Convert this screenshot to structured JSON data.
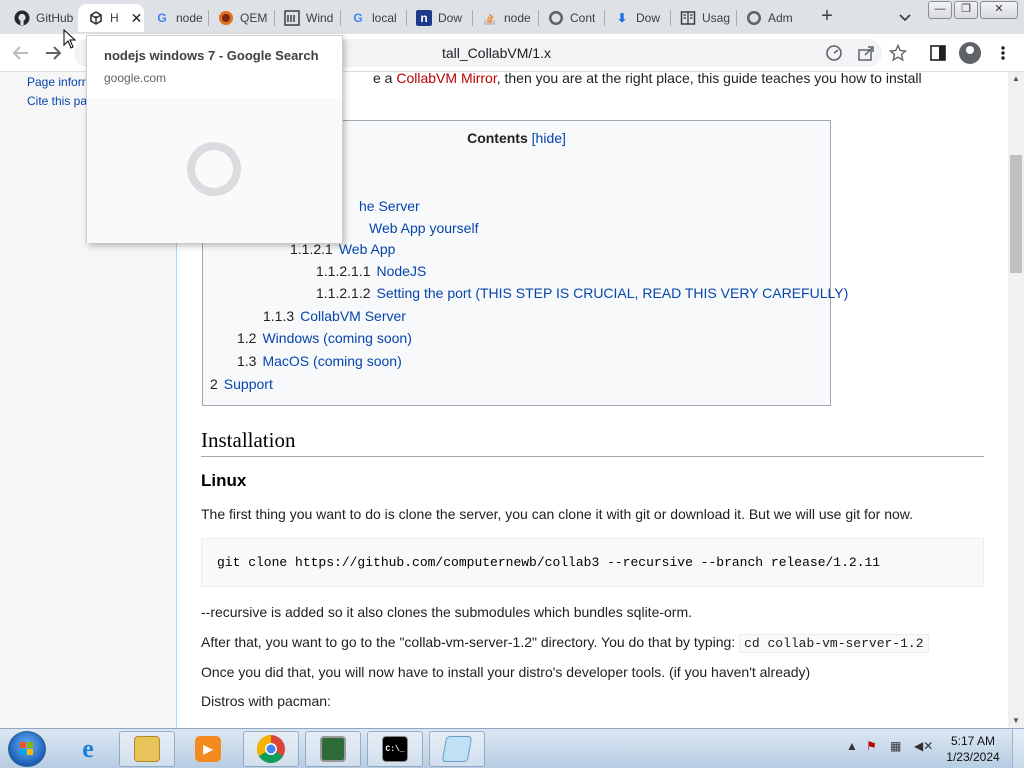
{
  "browser": {
    "tabs": [
      {
        "title": "GitHub",
        "icon": "github-icon"
      },
      {
        "title": "H",
        "icon": "collabvm-icon",
        "active": true
      },
      {
        "title": "node",
        "icon": "google-icon"
      },
      {
        "title": "QEM",
        "icon": "qemu-icon"
      },
      {
        "title": "Wind",
        "icon": "wikipedia-icon"
      },
      {
        "title": "local",
        "icon": "google-icon"
      },
      {
        "title": "Dow",
        "icon": "nodejs-n-icon"
      },
      {
        "title": "node",
        "icon": "stackoverflow-icon"
      },
      {
        "title": "Cont",
        "icon": "globe-icon"
      },
      {
        "title": "Dow",
        "icon": "download-icon"
      },
      {
        "title": "Usag",
        "icon": "book-icon"
      },
      {
        "title": "Adm",
        "icon": "globe-icon"
      }
    ],
    "new_tab": "+",
    "close_tab": "✕",
    "address": "tall_CollabVM/1.x",
    "window_controls": {
      "minimize": "—",
      "restore": "❐",
      "close": "✕"
    }
  },
  "hover_card": {
    "title": "nodejs windows 7 - Google Search",
    "domain": "google.com"
  },
  "sidebar": {
    "links": [
      "Page inforr",
      "Cite this pa"
    ]
  },
  "article": {
    "intro_prefix": "e a ",
    "intro_link": "CollabVM Mirror",
    "intro_suffix": ", then you are at the right place, this guide teaches you how to install",
    "toc": {
      "title": "Contents",
      "hide_open": "[",
      "hide": "hide",
      "hide_close": "]",
      "items": [
        {
          "num": "",
          "text": "he Server"
        },
        {
          "num": "",
          "text": "Web App yourself"
        },
        {
          "num": "1.1.2.1",
          "text": "Web App"
        },
        {
          "num": "1.1.2.1.1",
          "text": "NodeJS"
        },
        {
          "num": "1.1.2.1.2",
          "text": "Setting the port (THIS STEP IS CRUCIAL, READ THIS VERY CAREFULLY)"
        },
        {
          "num": "1.1.3",
          "text": "CollabVM Server"
        },
        {
          "num": "1.2",
          "text": "Windows (coming soon)"
        },
        {
          "num": "1.3",
          "text": "MacOS (coming soon)"
        },
        {
          "num": "2",
          "text": "Support"
        }
      ]
    },
    "heading": "Installation",
    "subheading": "Linux",
    "p1": "The first thing you want to do is clone the server, you can clone it with git or download it. But we will use git for now.",
    "code1": "git clone https://github.com/computernewb/collab3 --recursive --branch release/1.2.11",
    "p2": "--recursive is added so it also clones the submodules which bundles sqlite-orm.",
    "p3_text": "After that, you want to go to the \"collab-vm-server-1.2\" directory. You do that by typing: ",
    "p3_code": "cd collab-vm-server-1.2",
    "p4": "Once you did that, you will now have to install your distro's developer tools. (if you haven't already)",
    "p5": "Distros with pacman:"
  },
  "taskbar": {
    "apps": [
      "internet-explorer-icon",
      "file-explorer-icon",
      "media-player-icon",
      "chrome-icon",
      "task-manager-icon",
      "command-prompt-icon",
      "notepad-icon"
    ],
    "cmd_label": "C:\\_",
    "time": "5:17 AM",
    "date": "1/23/2024"
  },
  "colors": {
    "link": "#0645ad",
    "red_link": "#ba0000",
    "tabstrip": "#dee1e6"
  }
}
